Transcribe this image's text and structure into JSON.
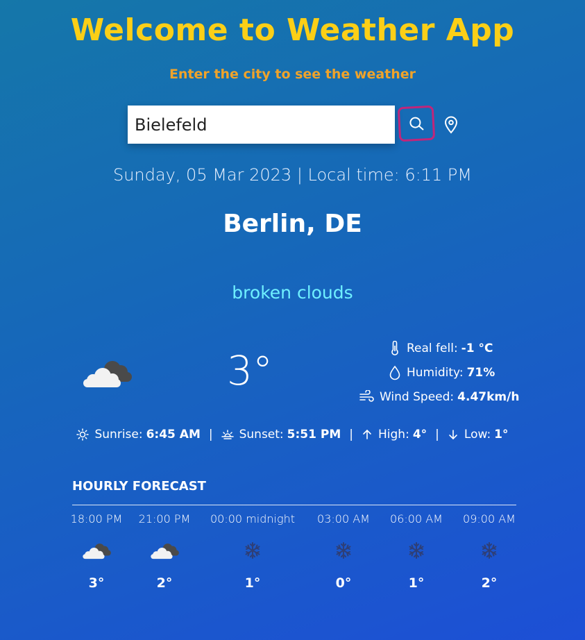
{
  "header": {
    "title": "Welcome to Weather App",
    "subtitle": "Enter the city to see the weather"
  },
  "search": {
    "value": "Bielefeld",
    "search_icon": "search-icon",
    "location_icon": "map-pin-icon"
  },
  "datetime": "Sunday, 05 Mar 2023 | Local time: 6:11 PM",
  "city": "Berlin, DE",
  "condition": "broken clouds",
  "current": {
    "temperature": "3°",
    "icon": "broken-clouds-icon",
    "real_feel_label": "Real fell:",
    "real_feel_value": "-1 °C",
    "humidity_label": "Humidity:",
    "humidity_value": "71%",
    "wind_label": "Wind Speed:",
    "wind_value": "4.47km/h"
  },
  "sun": {
    "sunrise_label": "Sunrise:",
    "sunrise_value": "6:45 AM",
    "sunset_label": "Sunset:",
    "sunset_value": "5:51 PM",
    "high_label": "High:",
    "high_value": "4°",
    "low_label": "Low:",
    "low_value": "1°",
    "separator": "|"
  },
  "hourly": {
    "title": "HOURLY FORECAST",
    "items": [
      {
        "time": "18:00 PM",
        "icon": "broken-clouds-icon",
        "temp": "3°"
      },
      {
        "time": "21:00 PM",
        "icon": "broken-clouds-icon",
        "temp": "2°"
      },
      {
        "time": "00:00 midnight",
        "icon": "snowflake-icon",
        "temp": "1°"
      },
      {
        "time": "03:00 AM",
        "icon": "snowflake-icon",
        "temp": "0°"
      },
      {
        "time": "06:00 AM",
        "icon": "snowflake-icon",
        "temp": "1°"
      },
      {
        "time": "09:00 AM",
        "icon": "snowflake-icon",
        "temp": "2°"
      }
    ]
  },
  "colors": {
    "title": "#fbcf17",
    "subtitle": "#f0a32a",
    "condition": "#6ff0ff",
    "search_highlight": "#c0267a"
  }
}
